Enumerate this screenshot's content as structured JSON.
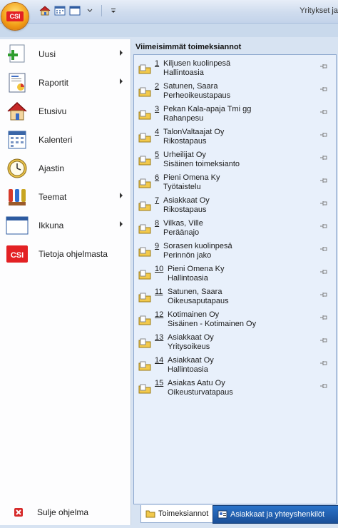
{
  "window": {
    "title": "Yritykset ja"
  },
  "app_orb": {
    "logo_text": "CSI"
  },
  "quick_access": [
    "home-icon",
    "calendar-icon",
    "window-icon",
    "dropdown-icon",
    "customize-icon"
  ],
  "menu": {
    "items": [
      {
        "label": "Uusi",
        "icon": "new-document-icon",
        "submenu": true
      },
      {
        "label": "Raportit",
        "icon": "report-icon",
        "submenu": true
      },
      {
        "label": "Etusivu",
        "icon": "home-icon",
        "submenu": false
      },
      {
        "label": "Kalenteri",
        "icon": "calendar-icon",
        "submenu": false
      },
      {
        "label": "Ajastin",
        "icon": "clock-icon",
        "submenu": false
      },
      {
        "label": "Teemat",
        "icon": "paint-icon",
        "submenu": true
      },
      {
        "label": "Ikkuna",
        "icon": "window-icon",
        "submenu": true
      },
      {
        "label": "Tietoja ohjelmasta",
        "icon": "csi-logo-icon",
        "submenu": false
      }
    ],
    "exit_label": "Sulje ohjelma"
  },
  "recent": {
    "title": "Viimeisimmät toimeksiannot",
    "items": [
      {
        "num": "1",
        "name": "Kiljusen kuolinpesä",
        "type": "Hallintoasia"
      },
      {
        "num": "2",
        "name": "Satunen, Saara",
        "type": "Perheoikeustapaus"
      },
      {
        "num": "3",
        "name": "Pekan Kala-apaja Tmi gg",
        "type": "Rahanpesu"
      },
      {
        "num": "4",
        "name": "TalonValtaajat Oy",
        "type": "Rikostapaus"
      },
      {
        "num": "5",
        "name": "Urheilijat Oy",
        "type": "Sisäinen toimeksianto"
      },
      {
        "num": "6",
        "name": "Pieni Omena Ky",
        "type": "Työtaistelu"
      },
      {
        "num": "7",
        "name": "Asiakkaat Oy",
        "type": "Rikostapaus"
      },
      {
        "num": "8",
        "name": "Vilkas, Ville",
        "type": "Peräänajo"
      },
      {
        "num": "9",
        "name": "Sorasen kuolinpesä",
        "type": "Perinnön jako"
      },
      {
        "num": "10",
        "name": "Pieni Omena Ky",
        "type": "Hallintoasia"
      },
      {
        "num": "11",
        "name": "Satunen, Saara",
        "type": "Oikeusaputapaus"
      },
      {
        "num": "12",
        "name": "Kotimainen Oy",
        "type": "Sisäinen - Kotimainen Oy"
      },
      {
        "num": "13",
        "name": "Asiakkaat Oy",
        "type": "Yritysoikeus"
      },
      {
        "num": "14",
        "name": "Asiakkaat Oy",
        "type": "Hallintoasia"
      },
      {
        "num": "15",
        "name": "Asiakas Aatu Oy",
        "type": "Oikeusturvatapaus"
      }
    ]
  },
  "tabs": [
    {
      "label": "Toimeksiannot",
      "active": true
    },
    {
      "label": "Asiakkaat ja yhteyshenkilöt",
      "active": false
    }
  ]
}
